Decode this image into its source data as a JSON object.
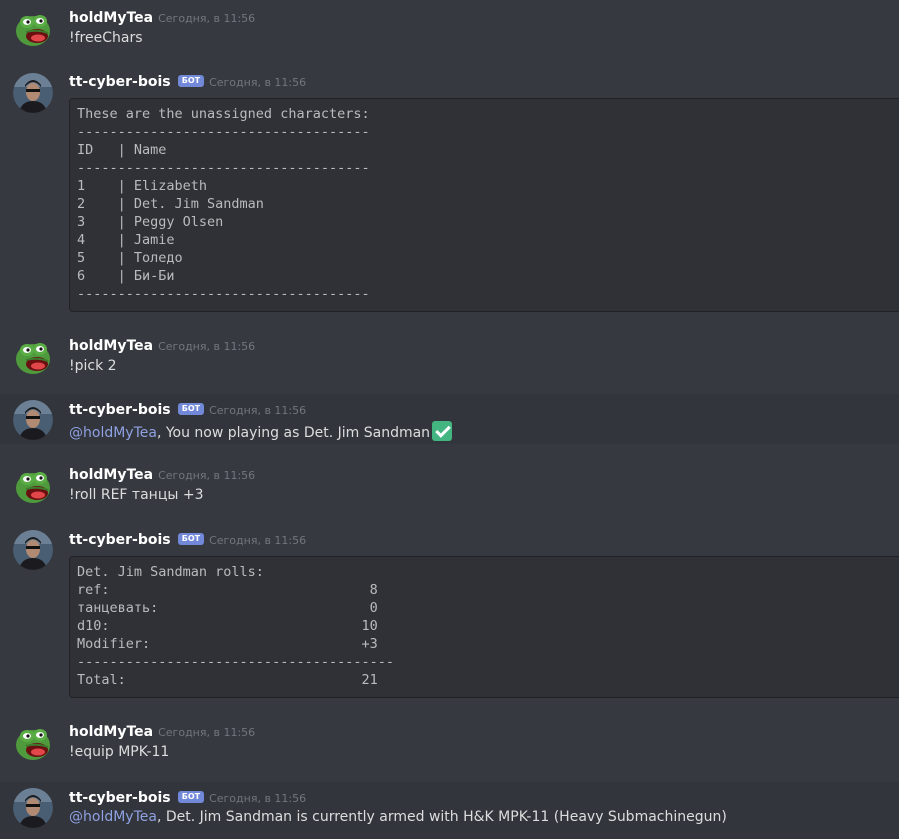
{
  "users": {
    "human": "holdMyTea",
    "bot": "tt-cyber-bois",
    "bot_badge": "БОТ"
  },
  "messages": [
    {
      "author": "holdMyTea",
      "time": "Сегодня, в 11:56",
      "text": "!freeChars"
    },
    {
      "author": "tt-cyber-bois",
      "time": "Сегодня, в 11:56",
      "code": "These are the unassigned characters:\n------------------------------------\nID   | Name\n------------------------------------\n1    | Elizabeth\n2    | Det. Jim Sandman\n3    | Peggy Olsen\n4    | Jamie\n5    | Толедо\n6    | Би-Би\n------------------------------------"
    },
    {
      "author": "holdMyTea",
      "time": "Сегодня, в 11:56",
      "text": "!pick 2"
    },
    {
      "author": "tt-cyber-bois",
      "time": "Сегодня, в 11:56",
      "mention": "@holdMyTea",
      "text": ", You now playing as Det. Jim Sandman",
      "emoji": "white-check-mark"
    },
    {
      "author": "holdMyTea",
      "time": "Сегодня, в 11:56",
      "text": "!roll REF танцы +3"
    },
    {
      "author": "tt-cyber-bois",
      "time": "Сегодня, в 11:56",
      "code": "Det. Jim Sandman rolls:\nref:                                8\nтанцевать:                          0\nd10:                               10\nModifier:                          +3\n---------------------------------------\nTotal:                             21"
    },
    {
      "author": "holdMyTea",
      "time": "Сегодня, в 11:56",
      "text": "!equip MPK-11"
    },
    {
      "author": "tt-cyber-bois",
      "time": "Сегодня, в 11:56",
      "mention": "@holdMyTea",
      "text": ", Det. Jim Sandman is currently armed with H&K MPK-11 (Heavy Submachinegun)"
    }
  ]
}
